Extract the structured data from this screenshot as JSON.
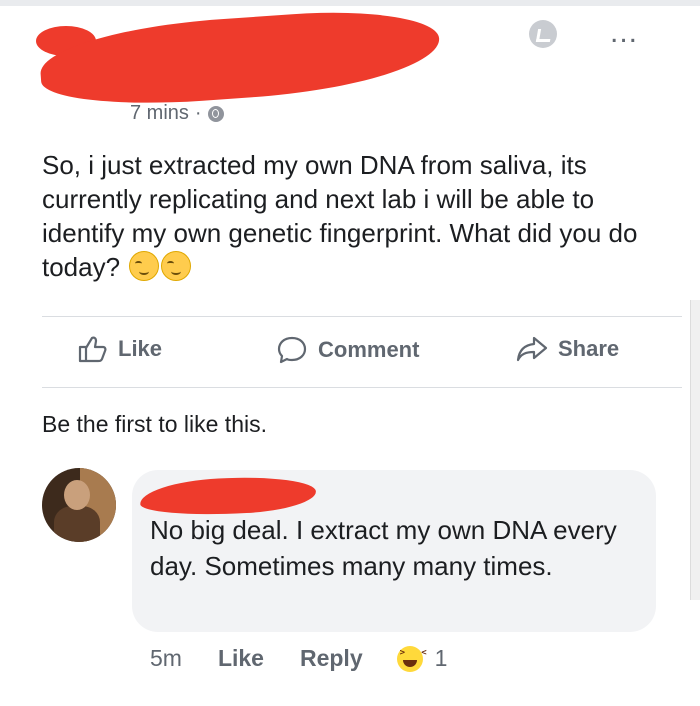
{
  "post": {
    "time": "7 mins",
    "separator": "·",
    "text": "So, i just extracted my own DNA from saliva, its currently replicating and next lab i will be able to identify my own genetic fingerprint. What did you do today?",
    "more": "...",
    "emoji_icons": [
      "smirk-emoji-icon",
      "smirk-emoji-icon"
    ]
  },
  "actions": {
    "like": "Like",
    "comment": "Comment",
    "share": "Share"
  },
  "reactions_summary": "Be the first to like this.",
  "comment": {
    "text": "No big deal. I extract my own DNA every day. Sometimes many many times.",
    "time": "5m",
    "like": "Like",
    "reply": "Reply",
    "reaction_count": "1",
    "reaction_icon": "haha-reaction-icon"
  },
  "colors": {
    "text": "#1c1e21",
    "secondary": "#606770",
    "redaction": "#ee3b2c",
    "comment_bubble": "#f2f3f5"
  }
}
